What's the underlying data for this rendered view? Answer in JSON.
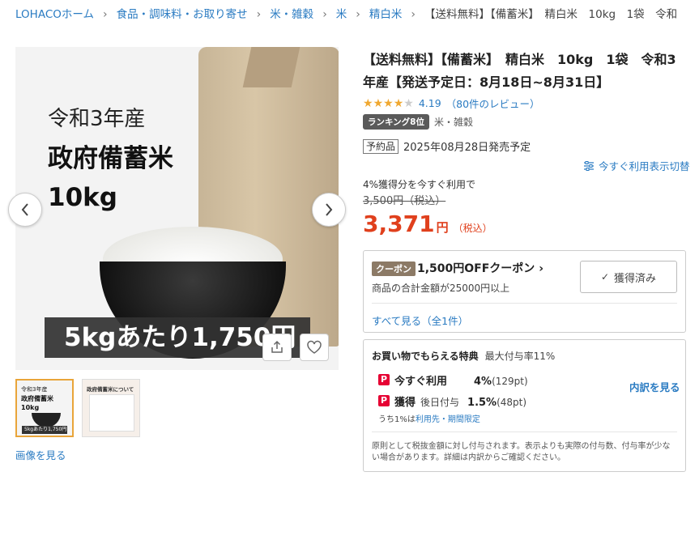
{
  "breadcrumb": {
    "items": [
      "LOHACOホーム",
      "食品・調味料・お取り寄せ",
      "米・雑穀",
      "米",
      "精白米"
    ],
    "current": "【送料無料】【備蓄米】　精白米　10kg　1袋　令和"
  },
  "gallery": {
    "line1": "令和3年産",
    "line2": "政府備蓄米",
    "line3": "10kg",
    "banner": "5kgあたり1,750円",
    "thumb1_lines": [
      "令和3年産",
      "政府備蓄米",
      "10kg",
      "5kgあたり1,750円"
    ],
    "thumb2_title": "政府備蓄米について",
    "view_images": "画像を見る"
  },
  "product": {
    "title": "【送料無料】【備蓄米】　精白米　10kg　1袋　令和3年産【発送予定日：8月18日~8月31日】",
    "rating_value": 4.19,
    "rating_text": "4.19",
    "review_text": "（80件のレビュー）",
    "rank_badge": "ランキング8位",
    "rank_category": "米・雑穀",
    "preorder_badge": "予約品",
    "release_text": "2025年08月28日発売予定",
    "switch_display": "今すぐ利用表示切替",
    "points_use_label": "4%獲得分を今すぐ利用で",
    "original_price": "3,500円（税込）",
    "price": "3,371",
    "price_yen": "円",
    "price_tax": "（税込）"
  },
  "coupon": {
    "badge": "クーポン",
    "title": "1,500円OFFクーポン",
    "condition": "商品の合計金額が25000円以上",
    "button": "獲得済み",
    "see_all": "すべて見る（全1件）"
  },
  "points": {
    "header": "お買い物でもらえる特典",
    "max_rate": "最大付与率11%",
    "rows": [
      {
        "name": "今すぐ利用",
        "sub": "",
        "rate": "4%",
        "pt": "(129pt)"
      },
      {
        "name": "獲得",
        "sub": "後日付与",
        "rate": "1.5%",
        "pt": "(48pt)"
      }
    ],
    "detail_link": "内訳を見る",
    "note_prefix": "うち1%は",
    "note_link": "利用先・期間限定",
    "footer": "原則として税抜金額に対し付与されます。表示よりも実際の付与数、付与率が少ない場合があります。詳細は内訳からご確認ください。"
  },
  "colors": {
    "accent_link": "#2a7bc2",
    "price_red": "#e0401d",
    "paypay_red": "#e60033",
    "star": "#f0a830"
  }
}
